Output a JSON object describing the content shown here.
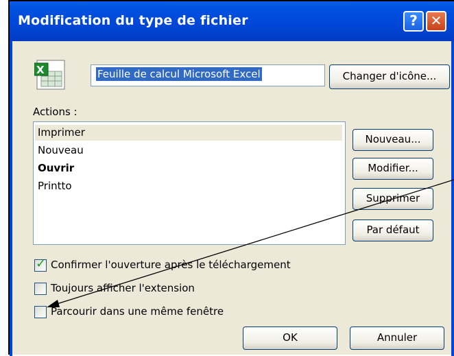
{
  "window": {
    "title": "Modification du type de fichier",
    "help_label": "?",
    "close_label": "✕"
  },
  "file_type": {
    "name": "Feuille de calcul Microsoft Excel",
    "change_icon_label": "Changer d'icône..."
  },
  "actions": {
    "label": "Actions :",
    "items": [
      {
        "label": "Imprimer",
        "selected": true
      },
      {
        "label": "Nouveau"
      },
      {
        "label": "Ouvrir",
        "default": true
      },
      {
        "label": "Printto"
      }
    ],
    "buttons": {
      "new": "Nouveau...",
      "edit": "Modifier...",
      "delete": "Supprimer",
      "default": "Par défaut"
    }
  },
  "options": [
    {
      "label": "Confirmer l'ouverture après le téléchargement",
      "checked": true
    },
    {
      "label": "Toujours afficher l'extension",
      "checked": false
    },
    {
      "label": "Parcourir dans une même fenêtre",
      "checked": false
    }
  ],
  "footer": {
    "ok_label": "OK",
    "cancel_label": "Annuler"
  },
  "colors": {
    "titlebar": "#0046d6",
    "selection": "#316ac5",
    "dialog_bg": "#ece9d8"
  }
}
